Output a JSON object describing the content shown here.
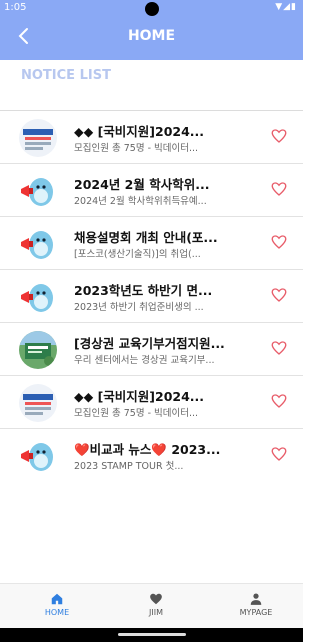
{
  "status": {
    "time": "1:05",
    "indicators": "▼◢▮"
  },
  "appbar": {
    "title": "HOME"
  },
  "notice": {
    "title": "NOTICE LIST"
  },
  "notices": [
    {
      "title": "◆◆ [국비지원]2024...",
      "subtitle": "모집인원 총 75명 - 빅데이터...",
      "thumb": "banner"
    },
    {
      "title": "2024년 2월 학사학위...",
      "subtitle": "2024년 2월 학사학위취득유예...",
      "thumb": "mascot"
    },
    {
      "title": "채용설명회 개최 안내(포...",
      "subtitle": "[포스코(생산기술직)]의 취업(...",
      "thumb": "mascot"
    },
    {
      "title": "2023학년도 하반기 면...",
      "subtitle": "2023년 하반기 취업준비생의 ...",
      "thumb": "mascot"
    },
    {
      "title": "[경상권 교육기부거점지원...",
      "subtitle": "우리 센터에서는 경상권 교육기부...",
      "thumb": "photo"
    },
    {
      "title": "◆◆ [국비지원]2024...",
      "subtitle": "모집인원 총 75명 - 빅데이터...",
      "thumb": "banner"
    },
    {
      "title": "❤️비교과 뉴스❤️ 2023...",
      "subtitle": "2023 STAMP TOUR 첫...",
      "thumb": "mascot"
    }
  ],
  "nav": {
    "home": "HOME",
    "jiim": "JIIM",
    "mypage": "MYPAGE"
  },
  "colors": {
    "appbar": "#8aa9f5",
    "notice_title": "#b7c7ef",
    "heart": "#e85d6a",
    "active_tab": "#2f7fe0"
  }
}
